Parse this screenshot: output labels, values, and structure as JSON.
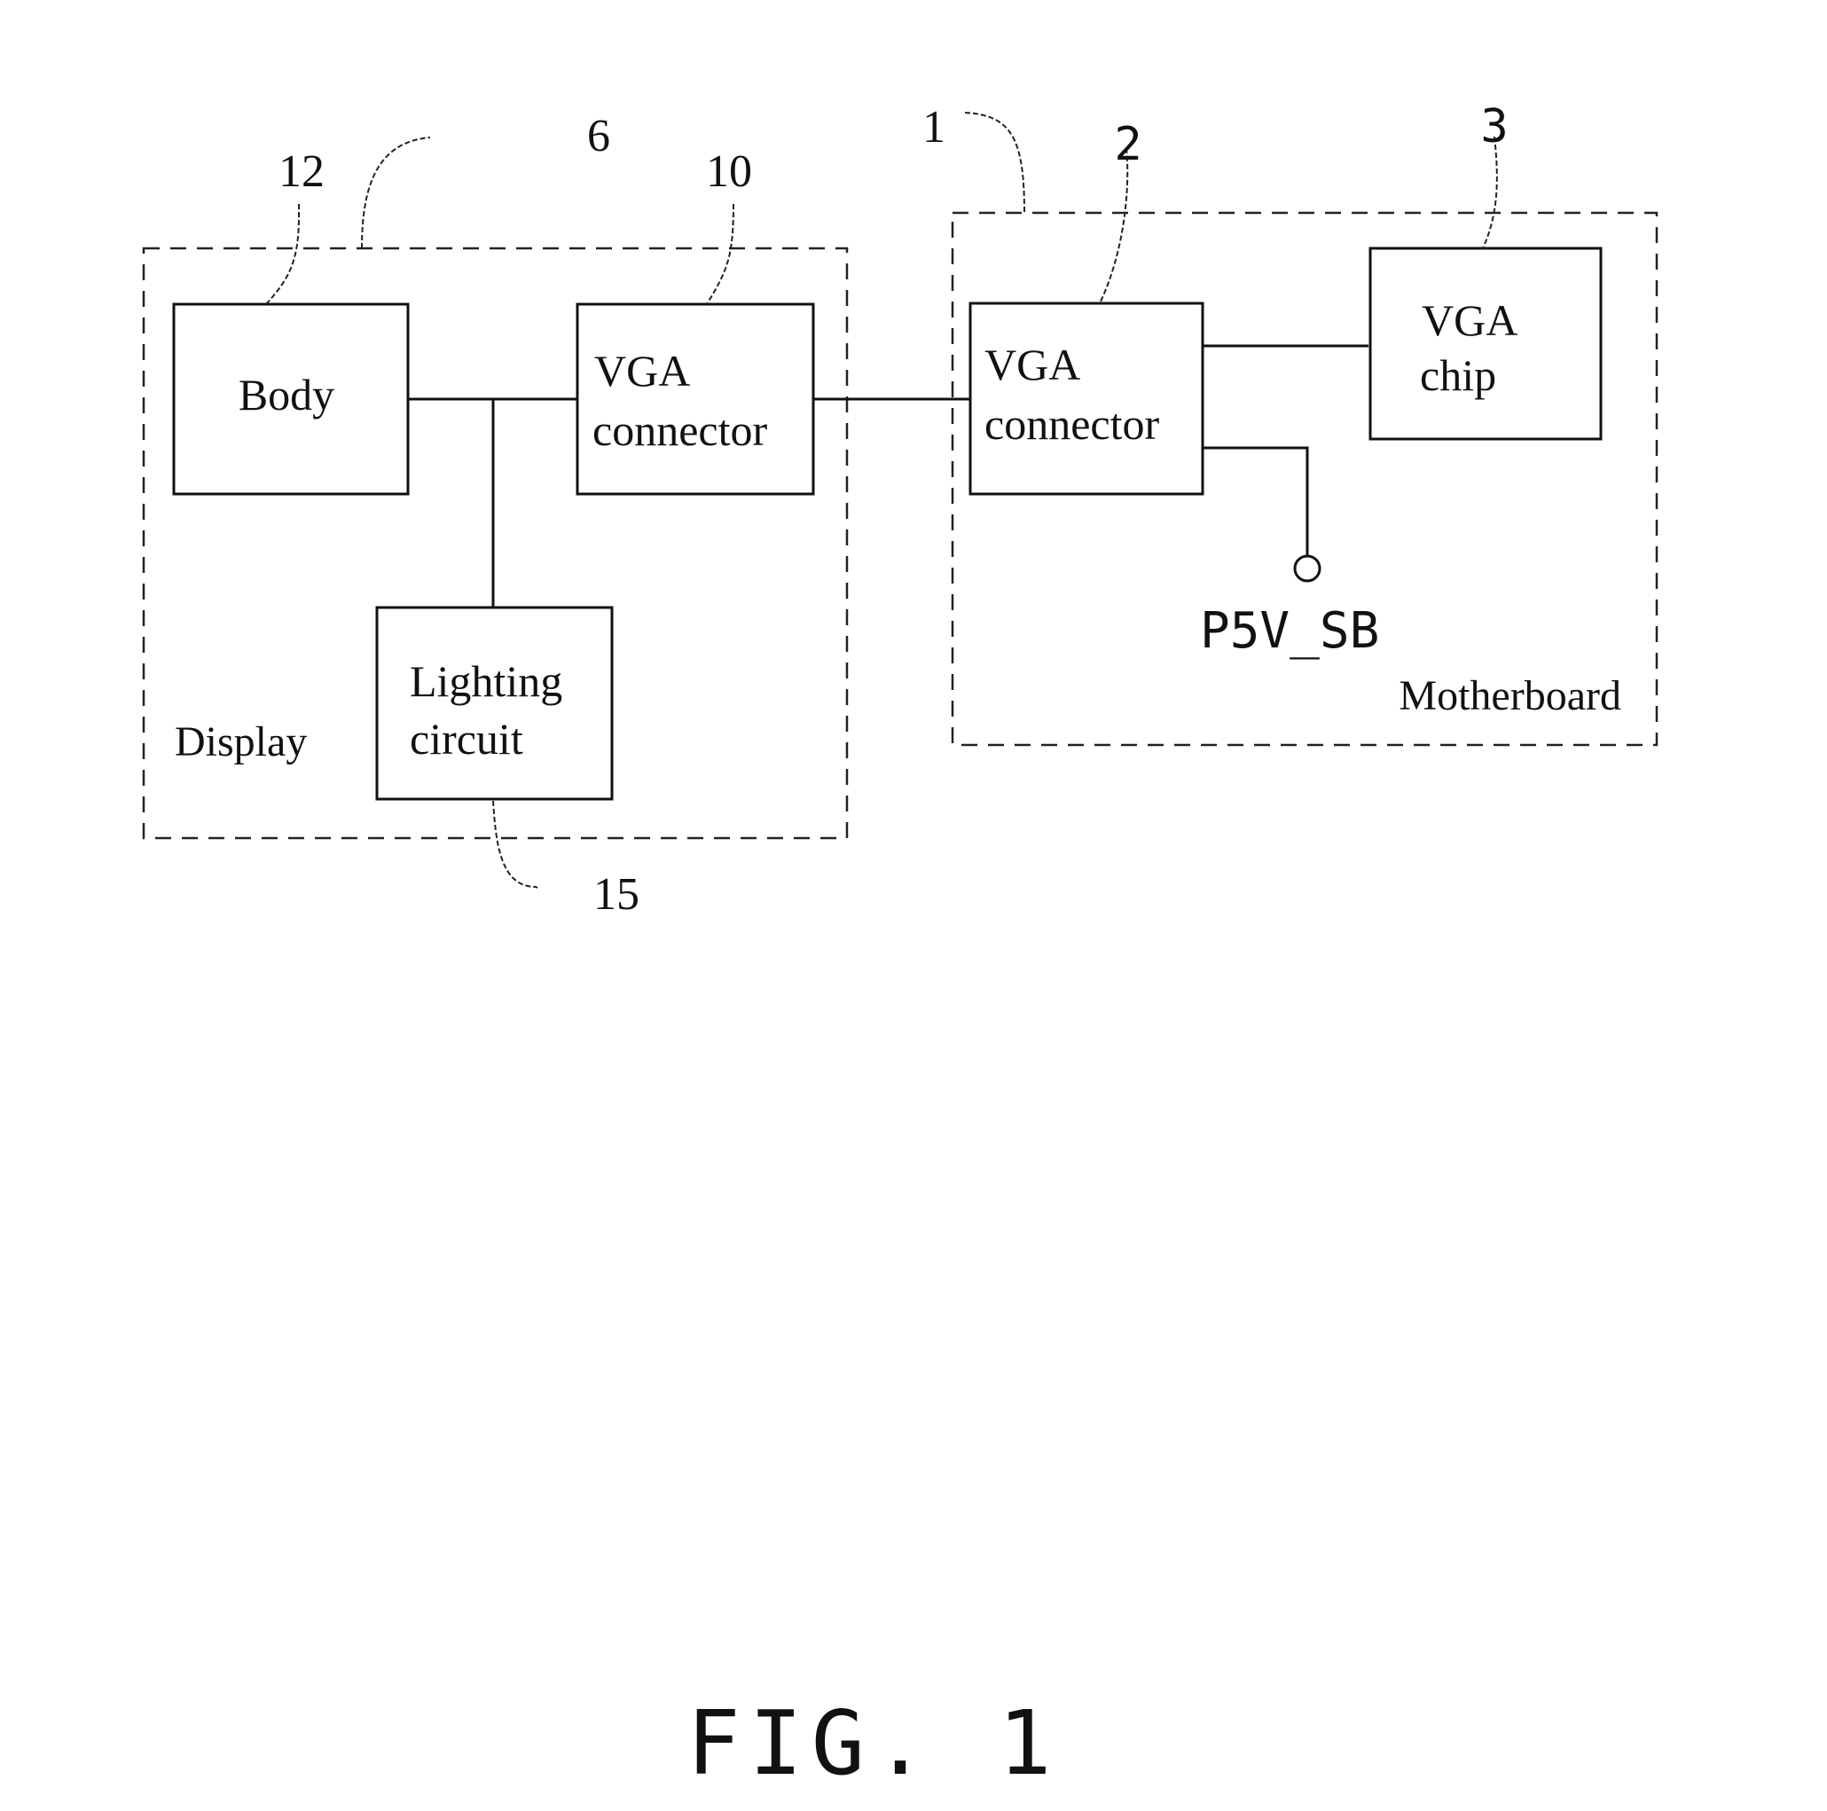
{
  "figure": {
    "caption": "FIG. 1",
    "groups": [
      {
        "id": "display",
        "label": "Display",
        "ref": "6"
      },
      {
        "id": "motherboard",
        "label": "Motherboard",
        "ref": "1"
      }
    ],
    "blocks": [
      {
        "id": "body",
        "lines": [
          "Body"
        ],
        "ref": "12"
      },
      {
        "id": "vga_connector_display",
        "lines": [
          "VGA",
          "connector"
        ],
        "ref": "10"
      },
      {
        "id": "lighting_circuit",
        "lines": [
          "Lighting",
          "circuit"
        ],
        "ref": "15"
      },
      {
        "id": "vga_connector_motherboard",
        "lines": [
          "VGA",
          "connector"
        ],
        "ref": "2"
      },
      {
        "id": "vga_chip",
        "lines": [
          "VGA",
          "chip"
        ],
        "ref": "3"
      }
    ],
    "terminal": {
      "label": "P5V_SB"
    },
    "connections": [
      [
        "body",
        "vga_connector_display"
      ],
      [
        "lighting_circuit",
        "body-vga_connector_display bus"
      ],
      [
        "vga_connector_display",
        "vga_connector_motherboard"
      ],
      [
        "vga_connector_motherboard",
        "vga_chip"
      ],
      [
        "vga_connector_motherboard",
        "P5V_SB"
      ]
    ]
  }
}
